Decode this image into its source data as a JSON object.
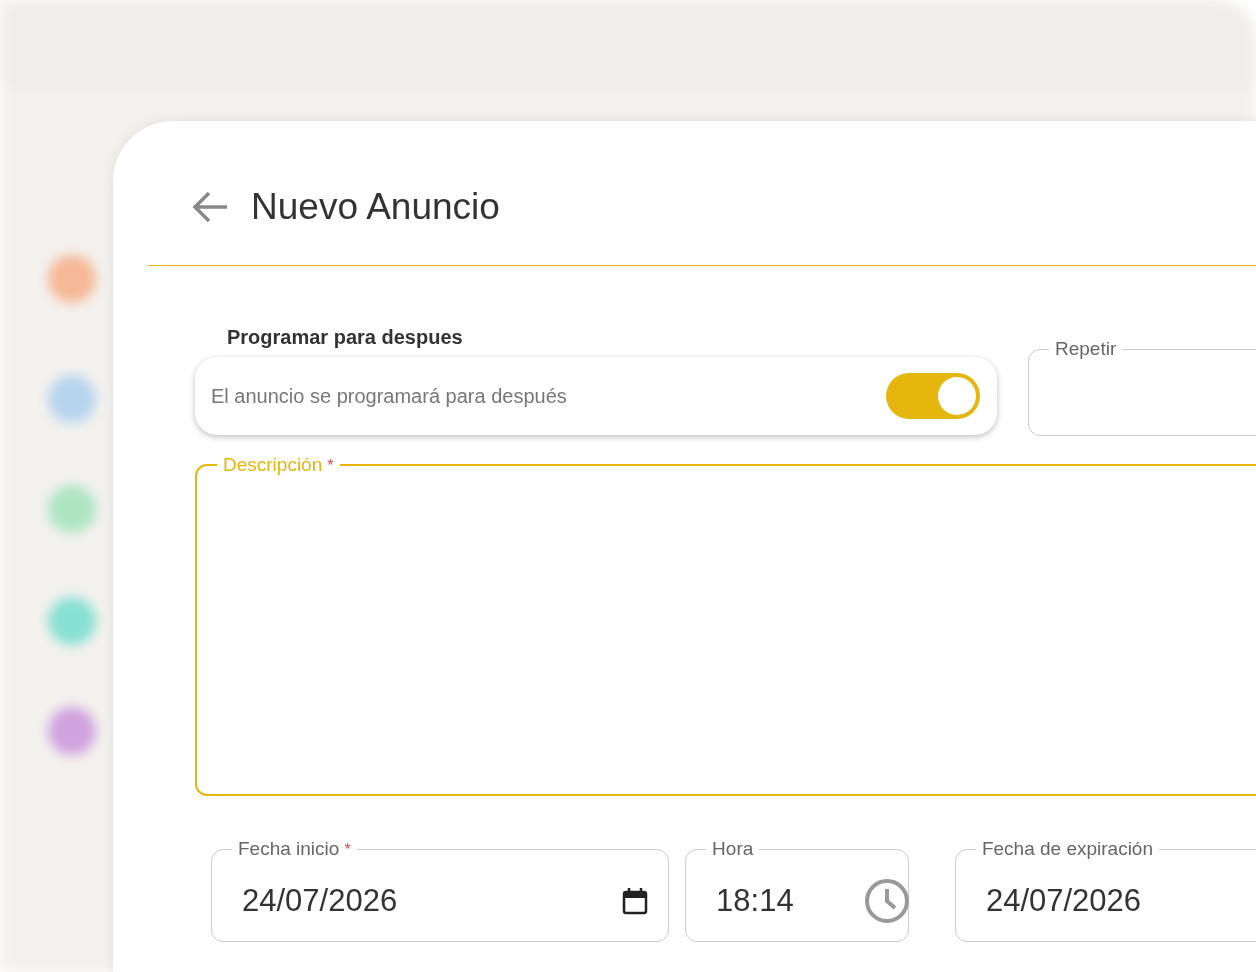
{
  "dialog": {
    "title": "Nuevo Anuncio"
  },
  "schedule": {
    "label": "Programar para despues",
    "description": "El anuncio se programará para después",
    "on": true
  },
  "repeat": {
    "label": "Repetir"
  },
  "description_field": {
    "label": "Descripción",
    "required_mark": "*",
    "focused": true
  },
  "start_date": {
    "label": "Fecha inicio",
    "required_mark": "*",
    "value": "24/07/2026"
  },
  "time": {
    "label": "Hora",
    "value": "18:14"
  },
  "expiration": {
    "label": "Fecha de expiración",
    "value": "24/07/2026"
  }
}
